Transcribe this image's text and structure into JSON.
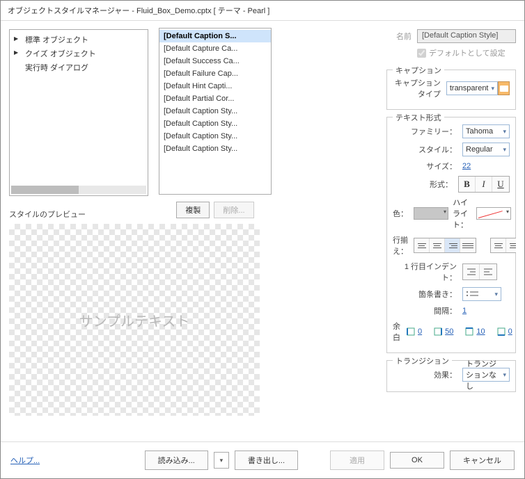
{
  "window": {
    "title": "オブジェクトスタイルマネージャー - Fluid_Box_Demo.cptx [ テーマ - Pearl ]"
  },
  "tree": {
    "items": [
      {
        "label": "標準 オブジェクト",
        "expandable": true
      },
      {
        "label": "クイズ オブジェクト",
        "expandable": true
      },
      {
        "label": "実行時 ダイアログ",
        "expandable": false
      }
    ]
  },
  "styleList": {
    "items": [
      "[Default Caption S...",
      "[Default Capture Ca...",
      "[Default Success Ca...",
      "[Default Failure Cap...",
      "[Default Hint Capti...",
      "[Default Partial Cor...",
      "[Default Caption Sty...",
      "[Default Caption Sty...",
      "[Default Caption Sty...",
      "[Default Caption Sty..."
    ],
    "selected": 0
  },
  "midButtons": {
    "clone": "複製",
    "delete": "削除..."
  },
  "preview": {
    "label": "スタイルのプレビュー",
    "sample": "サンプルテキスト"
  },
  "nameRow": {
    "label": "名前",
    "value": "[Default Caption Style]",
    "checkboxLabel": "デフォルトとして設定"
  },
  "captionGroup": {
    "title": "キャプション",
    "typeLabel": "キャプションタイプ",
    "typeValue": "transparent"
  },
  "textGroup": {
    "title": "テキスト形式",
    "familyLabel": "ファミリー：",
    "familyValue": "Tahoma",
    "styleLabel": "スタイル：",
    "styleValue": "Regular",
    "sizeLabel": "サイズ：",
    "sizeValue": "22",
    "formatLabel": "形式：",
    "colorLabel": "色：",
    "highlightLabel": "ハイライト：",
    "alignLabel": "行揃え：",
    "indentLabel": "1 行目インデント：",
    "bulletLabel": "箇条書き：",
    "spacingLabel": "間隔：",
    "spacingValue": "1",
    "marginLabel": "余白",
    "marginLeft": "0",
    "marginRight": "50",
    "marginTop": "10",
    "marginBottom": "0"
  },
  "transitionGroup": {
    "title": "トランジション",
    "effectLabel": "効果：",
    "effectValue": "トランジションなし"
  },
  "footer": {
    "help": "ヘルプ...",
    "import": "読み込み...",
    "export": "書き出し...",
    "apply": "適用",
    "ok": "OK",
    "cancel": "キャンセル"
  }
}
